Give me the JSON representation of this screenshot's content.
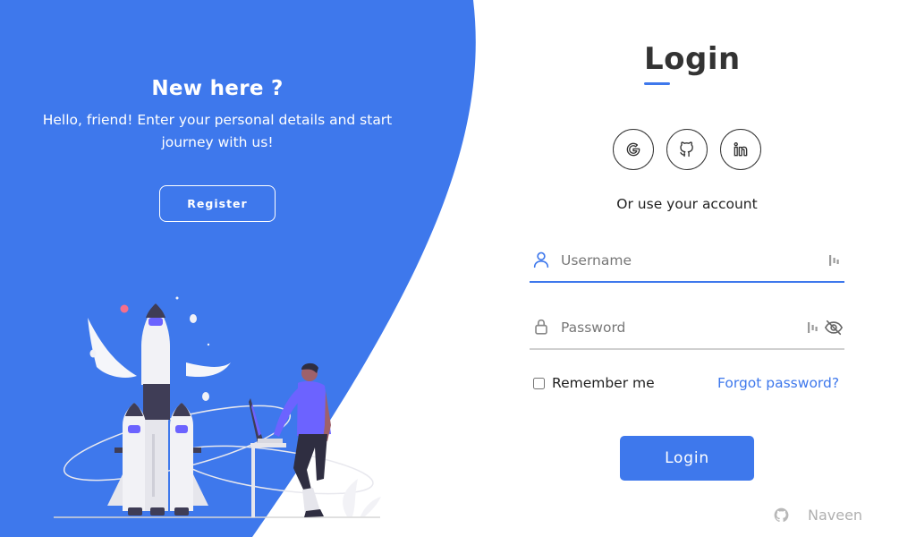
{
  "welcome": {
    "title": "New here ?",
    "text": "Hello, friend! Enter your personal details and start journey with us!",
    "register_label": "Register"
  },
  "login": {
    "title": "Login",
    "social": [
      {
        "name": "google-icon"
      },
      {
        "name": "github-icon"
      },
      {
        "name": "linkedin-icon"
      }
    ],
    "or_text": "Or use your account",
    "username_placeholder": "Username",
    "password_placeholder": "Password",
    "remember_label": "Remember me",
    "forgot_label": "Forgot password?",
    "button_label": "Login"
  },
  "footer": {
    "author": "Naveen"
  },
  "colors": {
    "accent": "#3e78ec",
    "text": "#333333",
    "muted": "#b0b0b0"
  }
}
